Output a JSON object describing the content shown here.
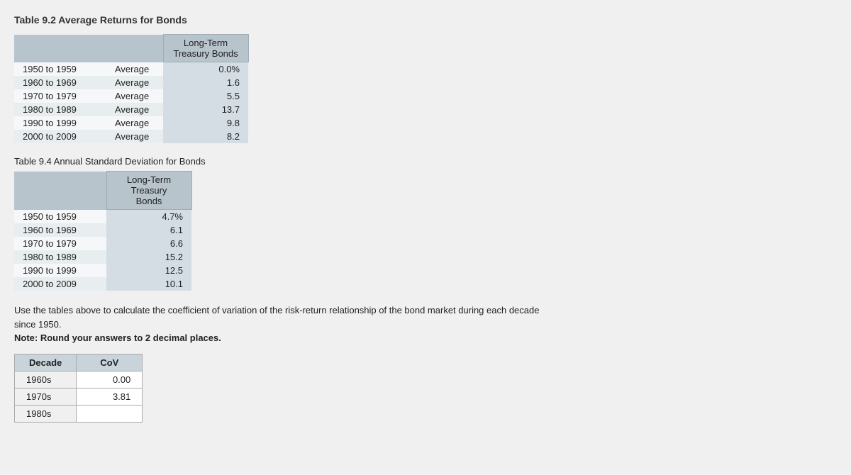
{
  "page": {
    "title": "Table 9.2 Average Returns for Bonds"
  },
  "table92": {
    "header": "Long-Term\nTreasury Bonds",
    "rows": [
      {
        "decade": "1950 to 1959",
        "type": "Average",
        "value": "0.0%"
      },
      {
        "decade": "1960 to 1969",
        "type": "Average",
        "value": "1.6"
      },
      {
        "decade": "1970 to 1979",
        "type": "Average",
        "value": "5.5"
      },
      {
        "decade": "1980 to 1989",
        "type": "Average",
        "value": "13.7"
      },
      {
        "decade": "1990 to 1999",
        "type": "Average",
        "value": "9.8"
      },
      {
        "decade": "2000 to 2009",
        "type": "Average",
        "value": "8.2"
      }
    ]
  },
  "table94": {
    "section_title": "Table 9.4 Annual Standard Deviation for Bonds",
    "header": "Long-Term Treasury\nBonds",
    "rows": [
      {
        "decade": "1950 to 1959",
        "value": "4.7%"
      },
      {
        "decade": "1960 to 1969",
        "value": "6.1"
      },
      {
        "decade": "1970 to 1979",
        "value": "6.6"
      },
      {
        "decade": "1980 to 1989",
        "value": "15.2"
      },
      {
        "decade": "1990 to 1999",
        "value": "12.5"
      },
      {
        "decade": "2000 to 2009",
        "value": "10.1"
      }
    ]
  },
  "instructions": {
    "line1": "Use the tables above to calculate the coefficient of variation of the risk-return relationship of the bond market during each decade",
    "line2": "since 1950.",
    "note": "Note: Round your answers to 2 decimal places."
  },
  "cov_table": {
    "col_decade": "Decade",
    "col_cov": "CoV",
    "rows": [
      {
        "decade": "1960s",
        "cov": "0.00"
      },
      {
        "decade": "1970s",
        "cov": "3.81"
      },
      {
        "decade": "1980s",
        "cov": ""
      }
    ]
  }
}
